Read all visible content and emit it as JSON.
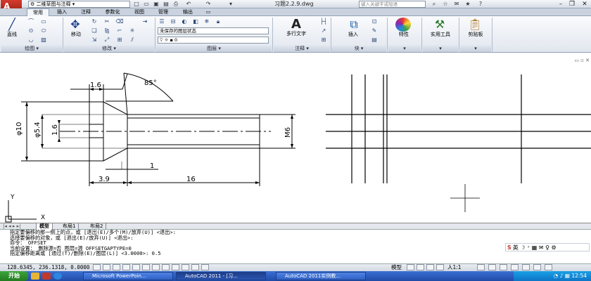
{
  "titlebar": {
    "workspace": "二维草图与注释",
    "document_title": "习题2.2.9.dwg",
    "search_placeholder": "键入关键字或短语"
  },
  "tabs": [
    "常用",
    "插入",
    "注释",
    "参数化",
    "视图",
    "管理",
    "输出"
  ],
  "active_tab": "常用",
  "ribbon": {
    "line_label": "直线",
    "move_label": "移动",
    "layer_state": "未保存的图层状态",
    "layer_current": "0",
    "mtext_label": "多行文字",
    "insert_label": "插入",
    "properties_label": "特性",
    "utilities_label": "实用工具",
    "clipboard_label": "剪贴板",
    "panels": {
      "draw": "绘图",
      "modify": "修改",
      "layers": "图层",
      "annotation": "注释",
      "block": "块"
    }
  },
  "drawing": {
    "dim_top_width": "1.6",
    "dim_angle": "85°",
    "dim_dia10": "φ10",
    "dim_dia54": "φ5.4",
    "dim_dia16": "1.6",
    "dim_small": "1",
    "dim_bottom_left": "3.9",
    "dim_bottom_right": "16",
    "dim_thread": "M6",
    "ucs_y": "Y",
    "ucs_x": "X"
  },
  "layout_tabs": [
    "模型",
    "布局1",
    "布局2"
  ],
  "command_lines": [
    "指定要偏移的那一侧上的点，或 [退出(E)/多个(M)/放弃(U)] <退出>:",
    "选择要偏移的对象，或 [退出(E)/放弃(U)] <退出>:",
    "命令：  OFFSET",
    "当前设置：  删除源=否   图层=源   OFFSETGAPTYPE=0",
    "指定偏移距离或 [通过(T)/删除(E)/图层(L)] <3.0000>:   0.5"
  ],
  "status": {
    "coords": "128.6345, 236.1318, 0.0000",
    "model_label": "模型",
    "annotation_scale": "人1:1"
  },
  "ime": "英",
  "taskbar": {
    "start": "开始",
    "tasks": [
      "Microsoft PowerPoin...",
      "AutoCAD 2011 - [习...",
      "AutoCAD 2011实例教..."
    ],
    "clock": "12:54"
  },
  "colors": {
    "title_bg": "#dfe5ee",
    "taskbar": "#2456b8",
    "start_green": "#2f8f2b",
    "accent_red": "#c0392b"
  }
}
